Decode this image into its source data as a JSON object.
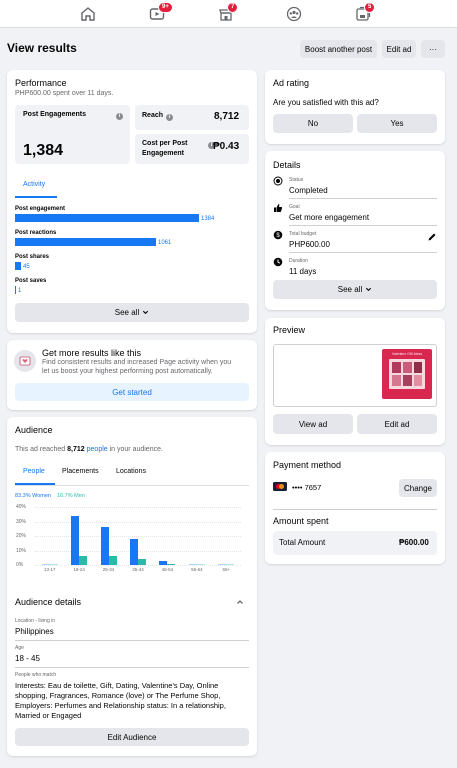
{
  "nav": {
    "items": [
      {
        "name": "home-icon",
        "badge": ""
      },
      {
        "name": "video-icon",
        "badge": "9+"
      },
      {
        "name": "marketplace-icon",
        "badge": "7"
      },
      {
        "name": "groups-icon",
        "badge": ""
      },
      {
        "name": "pages-icon",
        "badge": "5"
      }
    ]
  },
  "page": {
    "title": "View results",
    "boost_another": "Boost another post",
    "edit_ad": "Edit ad",
    "more": "···"
  },
  "performance": {
    "title": "Performance",
    "spent_amount": "PHP600.00",
    "spent_mid": " spent over ",
    "spent_days": "11 days",
    "spent_end": ".",
    "post_engagements_label": "Post Engagements",
    "post_engagements_value": "1,384",
    "reach_label": "Reach",
    "reach_value": "8,712",
    "cpe_label_1": "Cost per Post",
    "cpe_label_2": "Engagement",
    "cpe_value": "₱0.43",
    "tab_activity": "Activity",
    "see_all": "See all",
    "bars": [
      {
        "label": "Post engagement",
        "value": 1384,
        "display": "1384"
      },
      {
        "label": "Post reactions",
        "value": 1061,
        "display": "1061"
      },
      {
        "label": "Post shares",
        "value": 45,
        "display": "45"
      },
      {
        "label": "Post saves",
        "value": 1,
        "display": "1"
      }
    ]
  },
  "promo": {
    "title": "Get more results like this",
    "text_1": "Find consistent results and increased Page activity when you",
    "text_2": "let us boost your highest performing post automatically.",
    "cta": "Get started"
  },
  "audience": {
    "title": "Audience",
    "reach_pre": "This ad reached ",
    "reach_num": "8,712",
    "reach_link": "people",
    "reach_post": " in your audience.",
    "tabs": [
      "People",
      "Placements",
      "Locations"
    ],
    "women": "83.3% Women",
    "men": "16.7% Men",
    "details_title": "Audience details",
    "location_label": "Location - living in",
    "location_value": "Philippines",
    "age_label": "Age",
    "age_value": "18 - 45",
    "match_label": "People who match",
    "match_lines": [
      "Interests: Eau de toilette, Gift, Dating, Valentine's Day, Online",
      "shopping, Fragrances, Romance (love) or The Perfume Shop,",
      "Employers: Perfumes and Relationship status: In a relationship,",
      "Married or Engaged"
    ],
    "edit_button": "Edit Audience"
  },
  "ad_rating": {
    "title": "Ad rating",
    "question": "Are you satisfied with this ad?",
    "no": "No",
    "yes": "Yes"
  },
  "details": {
    "title": "Details",
    "status_label": "Status",
    "status_value": "Completed",
    "goal_label": "Goal",
    "goal_value": "Get more engagement",
    "budget_label": "Total budget",
    "budget_value": "PHP600.00",
    "duration_label": "Duration",
    "duration_value": "11 days",
    "see_all": "See all"
  },
  "preview": {
    "title": "Preview",
    "thumb_text": "Valentine Gift Ideas",
    "view_ad": "View ad",
    "edit_ad": "Edit ad"
  },
  "payment": {
    "title": "Payment method",
    "card": "•••• 7657",
    "change": "Change",
    "amount_title": "Amount spent",
    "total_label": "Total Amount",
    "total_value": "₱600.00"
  },
  "colors": {
    "brand": "#1877f2",
    "teal": "#2abba7",
    "link": "#1b74e4"
  },
  "chart_data": {
    "type": "bar",
    "categories": [
      "13-17",
      "18-24",
      "25-34",
      "35-44",
      "45-54",
      "55-64",
      "65+"
    ],
    "series": [
      {
        "name": "83.3% Women",
        "color": "#1877f2",
        "values": [
          0,
          34,
          26,
          18,
          3,
          0,
          0
        ]
      },
      {
        "name": "16.7% Men",
        "color": "#2abba7",
        "values": [
          0,
          6,
          6,
          4,
          1,
          0,
          0
        ]
      }
    ],
    "yticks": [
      "40%",
      "30%",
      "20%",
      "10%",
      "0%"
    ],
    "ylim": [
      0,
      40
    ],
    "grid": true
  }
}
